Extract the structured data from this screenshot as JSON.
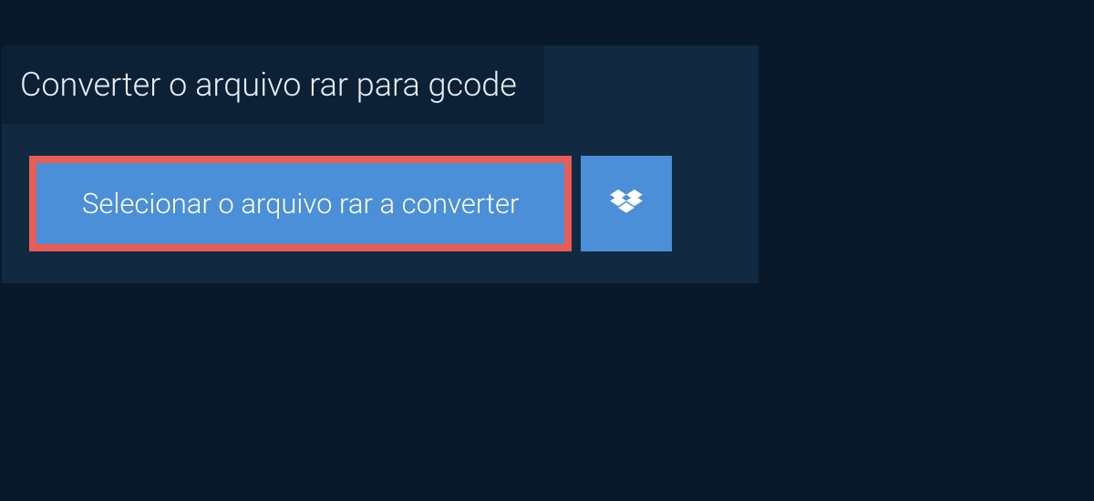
{
  "panel": {
    "title": "Converter o arquivo rar para gcode"
  },
  "actions": {
    "select_button_label": "Selecionar o arquivo rar a converter"
  },
  "colors": {
    "background": "#0a1929",
    "panel": "#112a42",
    "title_tab": "#0d2136",
    "button_primary": "#4a8fd8",
    "button_highlight_border": "#e85d55",
    "text_light": "#e8eef5",
    "text_white": "#ffffff"
  }
}
